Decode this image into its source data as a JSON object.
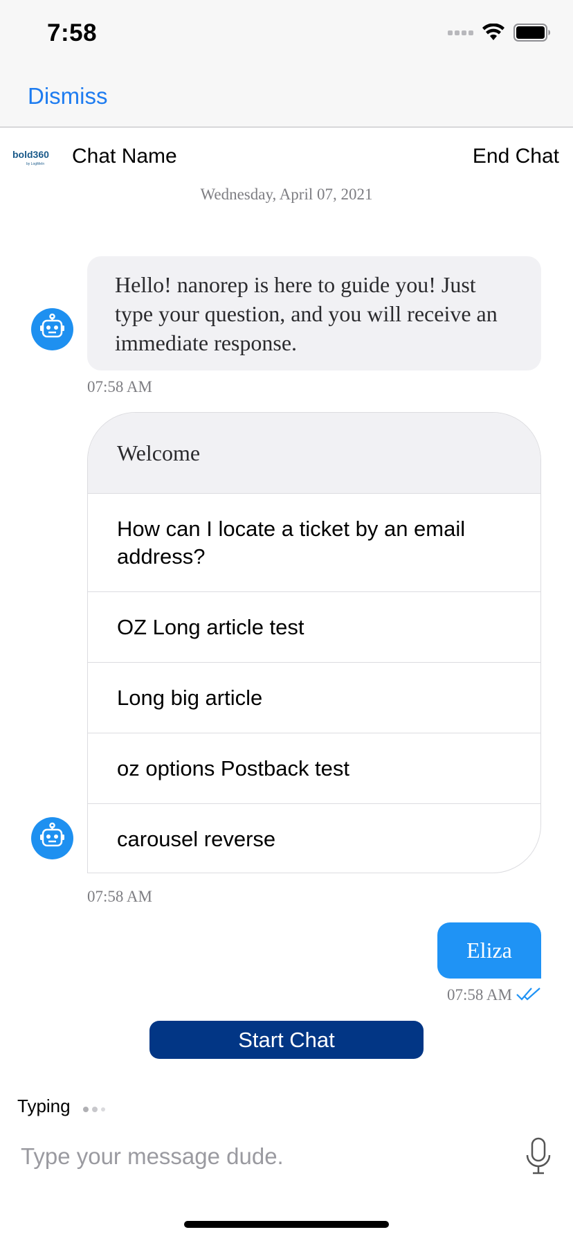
{
  "status_bar": {
    "time": "7:58"
  },
  "nav": {
    "dismiss_label": "Dismiss"
  },
  "chat_header": {
    "logo_text": "bold360",
    "logo_sub": "by LogMeIn",
    "chat_name": "Chat Name",
    "end_chat_label": "End Chat"
  },
  "date_label": "Wednesday, April 07, 2021",
  "messages": {
    "greeting": {
      "text": "Hello! nanorep is here to guide you! Just type your question, and you will receive an immediate response.",
      "time": "07:58 AM"
    },
    "options": {
      "title": "Welcome",
      "items": [
        {
          "label": "How can I locate a ticket by an email address?"
        },
        {
          "label": "OZ Long article test"
        },
        {
          "label": "Long big article"
        },
        {
          "label": "oz options Postback test"
        },
        {
          "label": "carousel reverse"
        }
      ],
      "time": "07:58 AM"
    },
    "outgoing": {
      "text": "Eliza",
      "time": "07:58 AM"
    }
  },
  "start_chat_label": "Start Chat",
  "typing": {
    "label": "Typing"
  },
  "composer": {
    "placeholder": "Type your message dude."
  },
  "colors": {
    "accent_blue": "#1e7cf0",
    "bubble_blue": "#1f93f5",
    "start_chat_navy": "#023685",
    "avatar_blue": "#1e90f0"
  },
  "icons": {
    "avatar": "bot-avatar-icon",
    "mic": "microphone-icon",
    "wifi": "wifi-icon",
    "battery": "battery-icon",
    "read_receipt": "double-check-icon"
  }
}
